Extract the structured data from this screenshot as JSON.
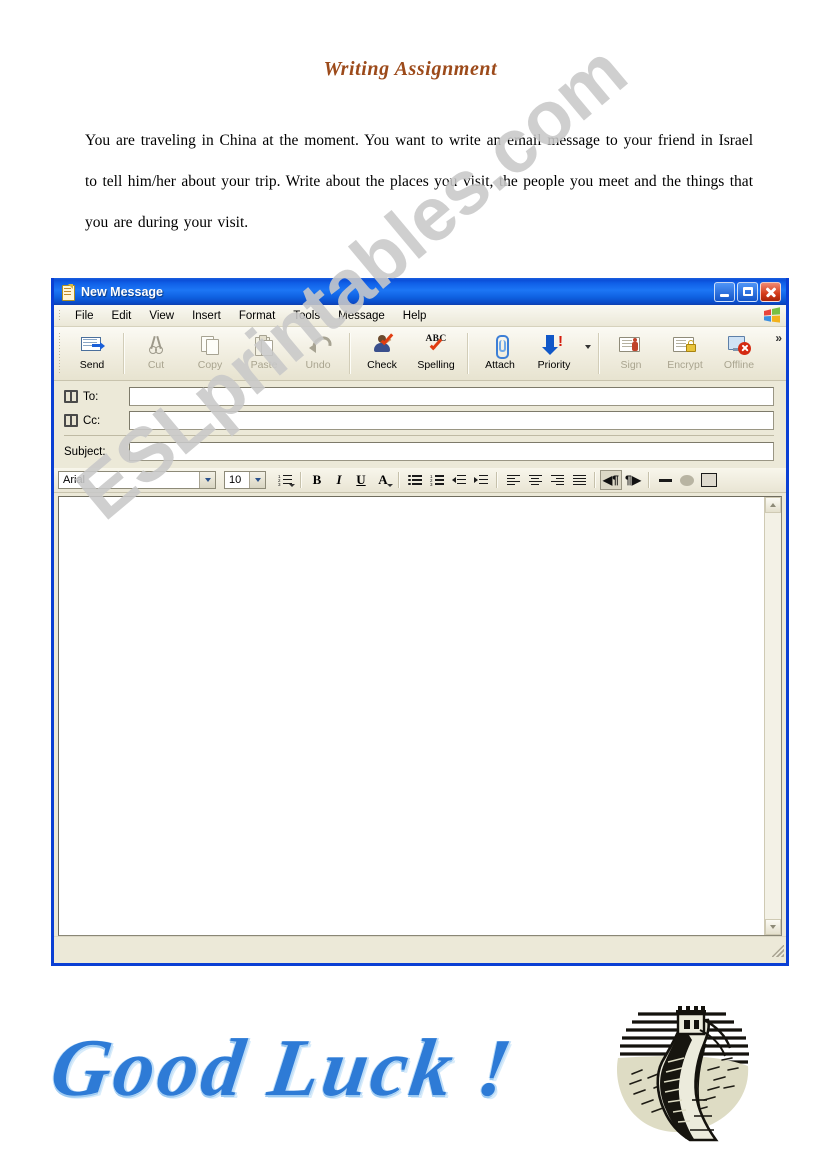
{
  "worksheet": {
    "title": "Writing Assignment",
    "instructions": "You are traveling in China at the moment. You want to write an email message to your friend in Israel to tell him/her about your trip. Write about the places you visit, the people you meet and the things that you are during your visit.",
    "footer_text": "Good Luck !",
    "watermark": "ESLprintables.com",
    "image_caption": "great-wall-of-china-woodcut"
  },
  "mail_window": {
    "title": "New Message",
    "window_controls": {
      "minimize": "minimize-button",
      "maximize": "maximize-button",
      "close": "close-button"
    },
    "menu": [
      {
        "label": "File"
      },
      {
        "label": "Edit"
      },
      {
        "label": "View"
      },
      {
        "label": "Insert"
      },
      {
        "label": "Format"
      },
      {
        "label": "Tools"
      },
      {
        "label": "Message"
      },
      {
        "label": "Help"
      }
    ],
    "toolbar": {
      "overflow_label": "»",
      "buttons": [
        {
          "label": "Send",
          "icon": "send-mail-icon",
          "enabled": true
        },
        {
          "label": "Cut",
          "icon": "scissors-icon",
          "enabled": false
        },
        {
          "label": "Copy",
          "icon": "copy-icon",
          "enabled": false
        },
        {
          "label": "Paste",
          "icon": "paste-icon",
          "enabled": false
        },
        {
          "label": "Undo",
          "icon": "undo-icon",
          "enabled": false
        },
        {
          "label": "Check",
          "icon": "check-names-icon",
          "enabled": true
        },
        {
          "label": "Spelling",
          "icon": "spelling-abc-icon",
          "enabled": true
        },
        {
          "label": "Attach",
          "icon": "paperclip-icon",
          "enabled": true
        },
        {
          "label": "Priority",
          "icon": "priority-arrow-icon",
          "enabled": true
        },
        {
          "label": "Sign",
          "icon": "digital-sign-icon",
          "enabled": true
        },
        {
          "label": "Encrypt",
          "icon": "encrypt-lock-icon",
          "enabled": true
        },
        {
          "label": "Offline",
          "icon": "work-offline-icon",
          "enabled": true
        }
      ]
    },
    "address_fields": [
      {
        "label": "To:",
        "value": "",
        "icon": "address-book-icon"
      },
      {
        "label": "Cc:",
        "value": "",
        "icon": "address-book-icon"
      },
      {
        "label": "Subject:",
        "value": "",
        "icon": null
      }
    ],
    "format_toolbar": {
      "font_family": "Arial",
      "font_size": "10",
      "bold_label": "B",
      "italic_label": "I",
      "underline_label": "U",
      "font_color_label": "A",
      "paragraph_style_icon": "paragraph-style-icon",
      "buttons": [
        {
          "icon": "bullet-list-icon"
        },
        {
          "icon": "numbered-list-icon"
        },
        {
          "icon": "decrease-indent-icon"
        },
        {
          "icon": "increase-indent-icon"
        },
        {
          "icon": "align-left-icon"
        },
        {
          "icon": "align-center-icon"
        },
        {
          "icon": "align-right-icon"
        },
        {
          "icon": "justify-icon"
        },
        {
          "icon": "ltr-paragraph-icon"
        },
        {
          "icon": "rtl-paragraph-icon"
        },
        {
          "icon": "horizontal-rule-icon"
        },
        {
          "icon": "insert-hyperlink-icon"
        },
        {
          "icon": "insert-picture-icon"
        }
      ]
    },
    "message_body": {
      "value": ""
    },
    "status_bar": {
      "text": ""
    }
  },
  "colors": {
    "title_brown": "#9C4A1A",
    "titlebar_blue": "#0B4FD8",
    "window_border_blue": "#0A3FD4",
    "chrome_beige": "#ECE9D8",
    "goodluck_blue": "#2E7BD6",
    "watermark_grey": "#C9C9C9"
  }
}
